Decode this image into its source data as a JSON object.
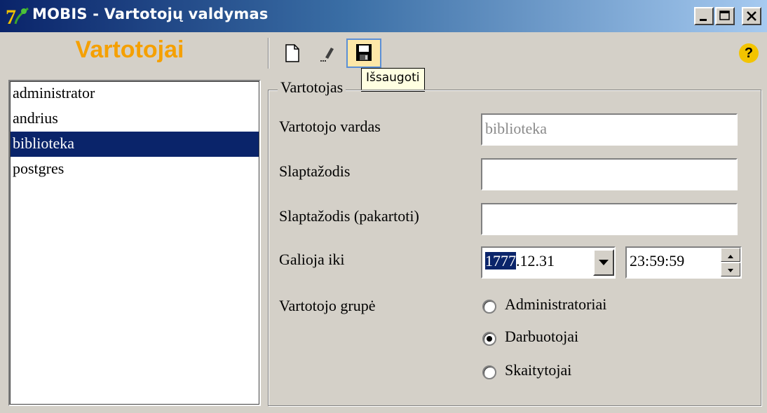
{
  "window": {
    "title": "MOBIS - Vartotojų valdymas"
  },
  "header": {
    "section_title": "Vartotojai"
  },
  "toolbar": {
    "new_icon": "new-document-icon",
    "edit_icon": "edit-icon",
    "save_icon": "save-disk-icon",
    "save_tooltip": "Išsaugoti",
    "help_label": "?"
  },
  "users": {
    "items": [
      "administrator",
      "andrius",
      "biblioteka",
      "postgres"
    ],
    "selected": "biblioteka"
  },
  "form": {
    "group_title": "Vartotojas",
    "username_label": "Vartotojo vardas",
    "username_value": "biblioteka",
    "password_label": "Slaptažodis",
    "password_repeat_label": "Slaptažodis (pakartoti)",
    "valid_until_label": "Galioja iki",
    "date_year": "1777",
    "date_rest": ".12.31",
    "time_value": "23:59:59",
    "group_label": "Vartotojo grupė",
    "group_options": [
      "Administratoriai",
      "Darbuotojai",
      "Skaitytojai"
    ],
    "group_selected": "Darbuotojai"
  },
  "colors": {
    "section_title": "#f5a000",
    "selection": "#0a246a",
    "window_bg": "#d4d0c8"
  }
}
